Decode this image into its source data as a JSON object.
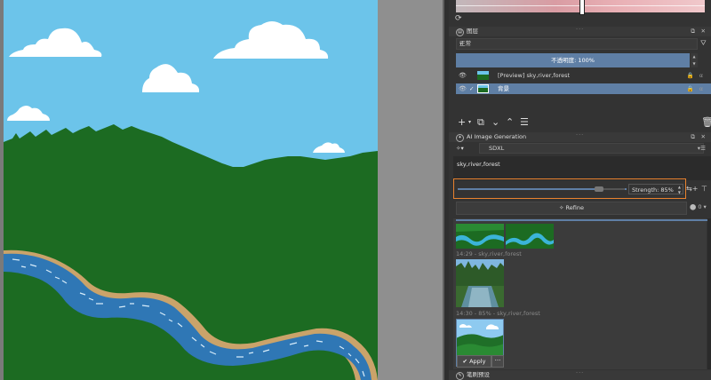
{
  "layers_panel": {
    "title": "图层",
    "blend_mode": "正常",
    "opacity_label": "不透明度: 100%",
    "layers": [
      {
        "name": "[Preview] sky,river,forest",
        "visible": true,
        "checked": false,
        "selected": false
      },
      {
        "name": "背景",
        "visible": true,
        "checked": true,
        "selected": true
      }
    ]
  },
  "ai_panel": {
    "title": "AI Image Generation",
    "model": "SDXL",
    "prompt": "sky,river,forest",
    "strength_label": "Strength: 85%",
    "strength": 0.85,
    "refine_label": "Refine",
    "seed": "0",
    "history": [
      {
        "label": "14:29 - sky,river,forest"
      },
      {
        "label": "14:30 - 85% - sky,river,forest"
      }
    ],
    "apply_label": "Apply",
    "more_label": "···"
  },
  "bottom_panel": {
    "title": "笔刷预设"
  },
  "icons": {
    "layers": "layers-icon",
    "eye": "eye-icon",
    "lock": "lock-icon",
    "ai": "ai-generation-icon",
    "wand": "wand-icon",
    "apply": "check-icon"
  },
  "colors": {
    "accent": "#5f7fa5",
    "highlight": "#e8822e",
    "sky": "#6cc4ea",
    "forest": "#1c6b22",
    "river": "#2f77b5"
  }
}
